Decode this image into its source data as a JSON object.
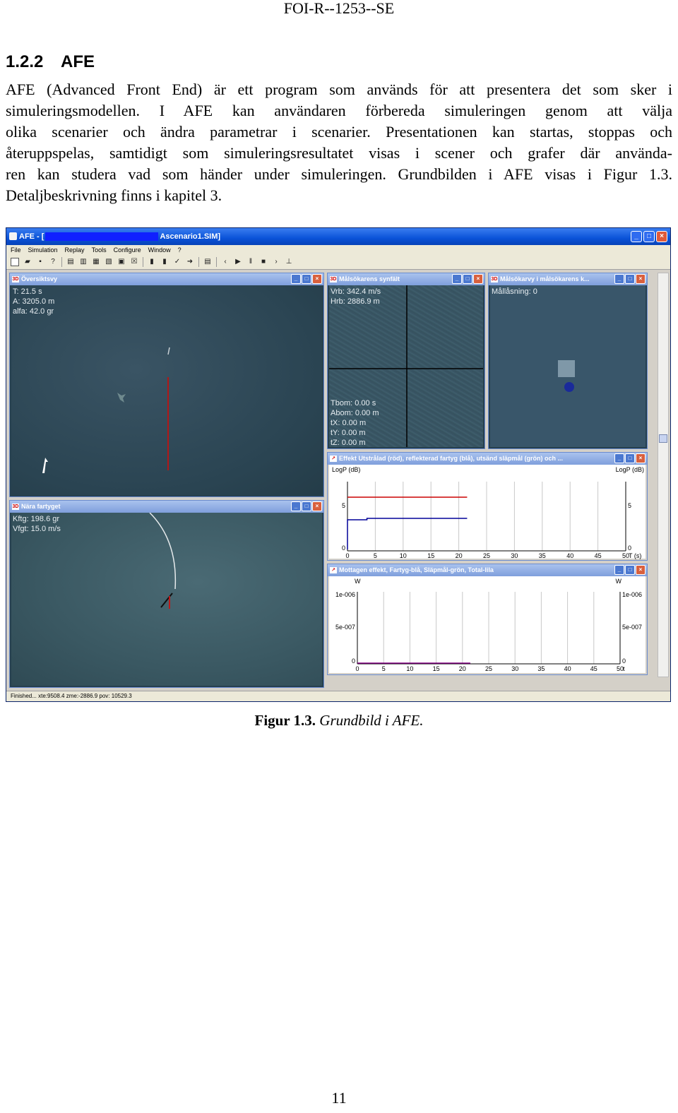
{
  "header": {
    "report_id": "FOI-R--1253--SE"
  },
  "section": {
    "number": "1.2.2",
    "title": "AFE"
  },
  "body_lines": [
    "AFE (Advanced Front End) är ett program som används för att presentera det som sker i",
    "simuleringsmodellen. I AFE kan användaren förbereda simuleringen genom att välja",
    "olika scenarier och ändra parametrar i scenarier. Presentationen kan startas, stoppas och",
    "återuppspelas, samtidigt som simuleringsresultatet visas i scener och grafer där använda-",
    "ren kan studera vad som händer under simuleringen. Grundbilden i AFE visas i Figur 1.3.",
    "Detaljbeskrivning finns i kapitel 3."
  ],
  "screenshot": {
    "title_prefix": "AFE - [",
    "title_suffix": "Ascenario1.SIM]",
    "menu": [
      "File",
      "Simulation",
      "Replay",
      "Tools",
      "Configure",
      "Window",
      "?"
    ],
    "status": "Finished...   xte:9508.4   zme:-2886.9 pov: 10529.3",
    "overview": {
      "title": "Översiktsvy",
      "lines": [
        "T: 21.5 s",
        "A: 3205.0 m",
        "alfa: 42.0 gr"
      ]
    },
    "seeker_view": {
      "title": "Målsökarens synfält",
      "top_lines": [
        "Vrb: 342.4 m/s",
        "Hrb: 2886.9 m"
      ],
      "bottom_lines": [
        "Tbom: 0.00 s",
        "Abom: 0.00 m",
        "tX: 0.00 m",
        "tY: 0.00 m",
        "tZ: 0.00 m"
      ]
    },
    "seeker_curve": {
      "title": "Målsökarvy i målsökarens k...",
      "lines": [
        "Mållåsning: 0"
      ]
    },
    "near_ship": {
      "title": "Nära fartyget",
      "lines": [
        "Kftg: 198.6 gr",
        "Vfgt: 15.0 m/s"
      ]
    },
    "graph1": {
      "title": "Effekt Utstrålad (röd), reflekterad fartyg (blå), utsänd släpmål (grön) och ...",
      "ylabel_left": "LogP (dB)",
      "ylabel_right": "LogP (dB)",
      "yticks": [
        "5",
        "0"
      ],
      "yticks_right": [
        "5",
        "0"
      ],
      "xticks": [
        "0",
        "5",
        "10",
        "15",
        "20",
        "25",
        "30",
        "35",
        "40",
        "45",
        "50"
      ],
      "xunit": "T (s)"
    },
    "graph2": {
      "title": "Mottagen effekt, Fartyg-blå, Släpmål-grön, Total-lila",
      "ylabel_left": "W",
      "ylabel_right": "W",
      "yticks": [
        "1e-006",
        "5e-007",
        "0"
      ],
      "yticks_right": [
        "1e-006",
        "5e-007",
        "0"
      ],
      "xticks": [
        "0",
        "5",
        "10",
        "15",
        "20",
        "25",
        "30",
        "35",
        "40",
        "45",
        "50"
      ],
      "xunit": "t"
    },
    "colors": {
      "radiated": "#cc0000",
      "reflected": "#000099",
      "total": "#800080"
    }
  },
  "caption": {
    "label": "Figur 1.3.",
    "text": "Grundbild i AFE."
  },
  "page_number": "11"
}
